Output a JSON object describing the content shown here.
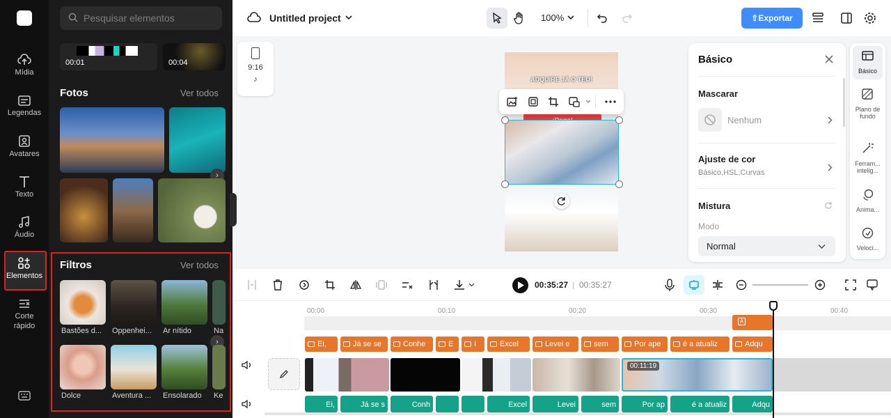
{
  "search": {
    "placeholder": "Pesquisar elementos"
  },
  "rail": {
    "items": [
      "Mídia",
      "Legendas",
      "Avatares",
      "Texto",
      "Áudio",
      "Elementos",
      "Corte rápido"
    ],
    "selected": "Elementos"
  },
  "videos": [
    {
      "duration": "00:01"
    },
    {
      "duration": "00:04"
    }
  ],
  "fotos": {
    "title": "Fotos",
    "see_all": "Ver todos"
  },
  "filtros": {
    "title": "Filtros",
    "see_all": "Ver todos",
    "items": [
      "Bastões d...",
      "Oppenhei...",
      "Ar nítido",
      "Na",
      "Dolce",
      "Aventura ...",
      "Ensolarado",
      "Ke"
    ]
  },
  "topbar": {
    "project_name": "Untitled project",
    "zoom": "100%",
    "export_label": "Exportar"
  },
  "ratio": {
    "label": "9:16"
  },
  "canvas": {
    "banner_top": "ADQUIRE JÁ O TEU!",
    "banner_red": "¡Pega!"
  },
  "basic": {
    "title": "Básico",
    "mascarar": {
      "label": "Mascarar",
      "value": "Nenhum"
    },
    "ajuste": {
      "label": "Ajuste de cor",
      "sub": "Básico,HSL,Curvas"
    },
    "mistura": {
      "label": "Mistura",
      "modo_label": "Modo",
      "modo_value": "Normal"
    }
  },
  "side_tabs": [
    "Básico",
    "Plano de fundo",
    "Ferram... intelig...",
    "Anima...",
    "Veloci..."
  ],
  "playback": {
    "current": "00:35:27",
    "separator": "|",
    "total": "00:35:27"
  },
  "ruler": [
    "00:00",
    "00:10",
    "00:20",
    "00:30",
    "00:40"
  ],
  "caption_clips": [
    "Ei, ",
    "Já se se",
    "Conhe",
    "E",
    "I",
    "Excel ",
    "Levei e",
    "sem ",
    "Por ape",
    "é a atualiz",
    "Adqu"
  ],
  "audio_clips": [
    "Ei,",
    "Já se s",
    "Conh",
    "Excel",
    "Levei",
    "sem",
    "Por ap",
    "é a atualiz",
    "Adqu"
  ],
  "clip_timestamp": "00:11:19",
  "colors": {
    "accent": "#3f8cff",
    "caption": "#e8762a",
    "audio": "#14a389",
    "selection": "#e02020",
    "cyan": "#23b8d6"
  }
}
